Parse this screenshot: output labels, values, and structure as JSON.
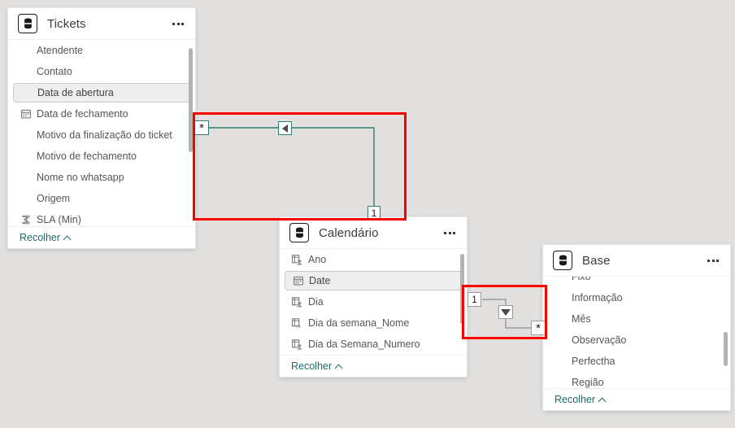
{
  "app": {
    "background_color": "#e1e0df",
    "accent_teal": "#1a6b6b",
    "relation_line_color": "#2e7d70",
    "highlight_color": "#f70000"
  },
  "tables": [
    {
      "id": "tickets",
      "title": "Tickets",
      "icon": "database-icon",
      "menu_label": "…",
      "collapse_label": "Recolher",
      "fields": [
        {
          "label": "Atendente",
          "icon": "none"
        },
        {
          "label": "Contato",
          "icon": "none"
        },
        {
          "label": "Data de abertura",
          "icon": "none",
          "selected": true
        },
        {
          "label": "Data de fechamento",
          "icon": "calendar-icon"
        },
        {
          "label": "Motivo da finalização do ticket",
          "icon": "none"
        },
        {
          "label": "Motivo de fechamento",
          "icon": "none"
        },
        {
          "label": "Nome no whatsapp",
          "icon": "none"
        },
        {
          "label": "Origem",
          "icon": "none"
        },
        {
          "label": "SLA (Min)",
          "icon": "sigma-icon"
        }
      ]
    },
    {
      "id": "calendario",
      "title": "Calendário",
      "icon": "database-icon",
      "menu_label": "…",
      "collapse_label": "Recolher",
      "fields": [
        {
          "label": "Ano",
          "icon": "summarized-column-icon"
        },
        {
          "label": "Date",
          "icon": "calendar-icon",
          "selected": true
        },
        {
          "label": "Dia",
          "icon": "summarized-column-icon"
        },
        {
          "label": "Dia da semana_Nome",
          "icon": "calculated-column-icon"
        },
        {
          "label": "Dia da Semana_Numero",
          "icon": "summarized-column-icon"
        }
      ]
    },
    {
      "id": "base",
      "title": "Base",
      "icon": "database-icon",
      "menu_label": "…",
      "collapse_label": "Recolher",
      "fields": [
        {
          "label": "Fixo",
          "icon": "none"
        },
        {
          "label": "Informação",
          "icon": "none"
        },
        {
          "label": "Mês",
          "icon": "none"
        },
        {
          "label": "Observação",
          "icon": "none"
        },
        {
          "label": "Perfectha",
          "icon": "none"
        },
        {
          "label": "Região",
          "icon": "none"
        }
      ]
    }
  ],
  "relationships": [
    {
      "id": "tickets-calendario",
      "from_cardinality": "*",
      "to_cardinality": "1",
      "cross_filter_direction": "single",
      "arrow_glyph": "arrow-left",
      "line_color": "#2e7d70",
      "highlighted": true
    },
    {
      "id": "calendario-base",
      "from_cardinality": "1",
      "to_cardinality": "*",
      "cross_filter_direction": "single",
      "arrow_glyph": "arrow-down",
      "line_color": "#9b9b9b",
      "highlighted": true
    }
  ],
  "annotations": {
    "red_boxes": 2,
    "note": "Two relationship connectors highlighted with red rectangles"
  }
}
